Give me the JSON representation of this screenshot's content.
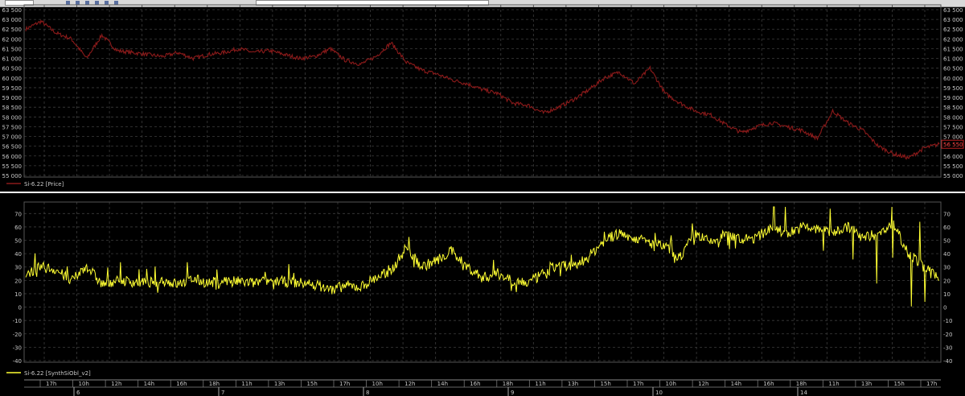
{
  "window": {
    "toolbar_icons": [
      "nav-left-icon",
      "nav-right-icon",
      "zoom-icon",
      "refresh-icon",
      "settings-icon",
      "chart-icon"
    ]
  },
  "colors": {
    "background": "#000000",
    "grid": "#3c3c3c",
    "axis_text": "#c8c8c8",
    "price_line": "#8b1a1a",
    "indicator_line": "#ffff33",
    "separator": "#ffffff",
    "toolbar": "#d9d9d9"
  },
  "chart_data": [
    {
      "type": "line",
      "title": "",
      "legend": [
        "Si-6.22 [Price]"
      ],
      "legend_position": "bottom-left",
      "ylim": [
        55000,
        63500
      ],
      "y_ticks": [
        "63 500",
        "63 000",
        "62 500",
        "62 000",
        "61 500",
        "61 000",
        "60 500",
        "60 000",
        "59 500",
        "59 000",
        "58 500",
        "58 000",
        "57 500",
        "57 000",
        "56 500",
        "56 000",
        "55 500",
        "55 000"
      ],
      "last_value": "56 550",
      "grid": true,
      "series": [
        {
          "name": "Si-6.22 [Price]",
          "color": "#8b1a1a",
          "x": [
            0,
            1,
            2,
            3,
            4,
            5,
            6,
            7,
            8,
            9,
            10,
            11,
            12,
            13,
            14,
            15,
            16,
            17,
            18,
            19,
            20,
            21,
            22,
            23,
            24,
            25,
            26,
            27,
            28,
            29,
            30,
            31,
            32,
            33,
            34,
            35,
            36,
            37,
            38,
            39,
            40,
            41,
            42,
            43,
            44,
            45,
            46,
            47,
            48,
            49,
            50,
            51,
            52,
            53,
            54,
            55,
            56,
            57,
            58,
            59,
            60
          ],
          "values": [
            62500,
            62900,
            62300,
            62000,
            61000,
            62200,
            61400,
            61300,
            61200,
            61100,
            61300,
            61000,
            61200,
            61300,
            61500,
            61300,
            61400,
            61200,
            61000,
            61100,
            61500,
            60900,
            60700,
            61100,
            61800,
            60800,
            60400,
            60200,
            59900,
            59700,
            59400,
            59200,
            58700,
            58600,
            58200,
            58500,
            58900,
            59400,
            60000,
            60300,
            59700,
            60500,
            59200,
            58700,
            58300,
            58100,
            57600,
            57200,
            57500,
            57700,
            57500,
            57300,
            56900,
            58300,
            57700,
            57300,
            56500,
            56100,
            55900,
            56400,
            56600
          ]
        }
      ]
    },
    {
      "type": "line",
      "title": "",
      "legend": [
        "Si-6.22 [SynthSiObl_v2]"
      ],
      "legend_position": "bottom-left",
      "ylim": [
        -40,
        75
      ],
      "y_ticks": [
        "70",
        "60",
        "50",
        "40",
        "30",
        "20",
        "10",
        "0",
        "-10",
        "-20",
        "-30",
        "-40"
      ],
      "grid": true,
      "series": [
        {
          "name": "Si-6.22 [SynthSiObl_v2]",
          "color": "#ffff33",
          "x": [
            0,
            1,
            2,
            3,
            4,
            5,
            6,
            7,
            8,
            9,
            10,
            11,
            12,
            13,
            14,
            15,
            16,
            17,
            18,
            19,
            20,
            21,
            22,
            23,
            24,
            25,
            26,
            27,
            28,
            29,
            30,
            31,
            32,
            33,
            34,
            35,
            36,
            37,
            38,
            39,
            40,
            41,
            42,
            43,
            44,
            45,
            46,
            47,
            48,
            49,
            50,
            51,
            52,
            53,
            54,
            55,
            56,
            57,
            58,
            59,
            60
          ],
          "values": [
            25,
            30,
            28,
            19,
            31,
            17,
            20,
            19,
            18,
            20,
            17,
            21,
            18,
            20,
            19,
            18,
            20,
            19,
            18,
            17,
            13,
            16,
            15,
            22,
            27,
            45,
            30,
            35,
            42,
            30,
            22,
            25,
            20,
            18,
            25,
            32,
            30,
            38,
            50,
            55,
            52,
            48,
            45,
            38,
            55,
            48,
            55,
            50,
            52,
            60,
            55,
            60,
            58,
            56,
            60,
            52,
            55,
            62,
            40,
            30,
            20
          ]
        }
      ]
    }
  ],
  "time_axis": {
    "hour_labels": [
      "17h",
      "10h",
      "12h",
      "14h",
      "16h",
      "18h",
      "11h",
      "13h",
      "15h",
      "17h",
      "10h",
      "12h",
      "14h",
      "16h",
      "18h",
      "11h",
      "13h",
      "15h",
      "17h",
      "10h",
      "12h",
      "14h",
      "16h",
      "18h",
      "11h",
      "13h",
      "15h",
      "17h"
    ],
    "day_labels": [
      "6",
      "7",
      "8",
      "9",
      "10",
      "14"
    ]
  }
}
